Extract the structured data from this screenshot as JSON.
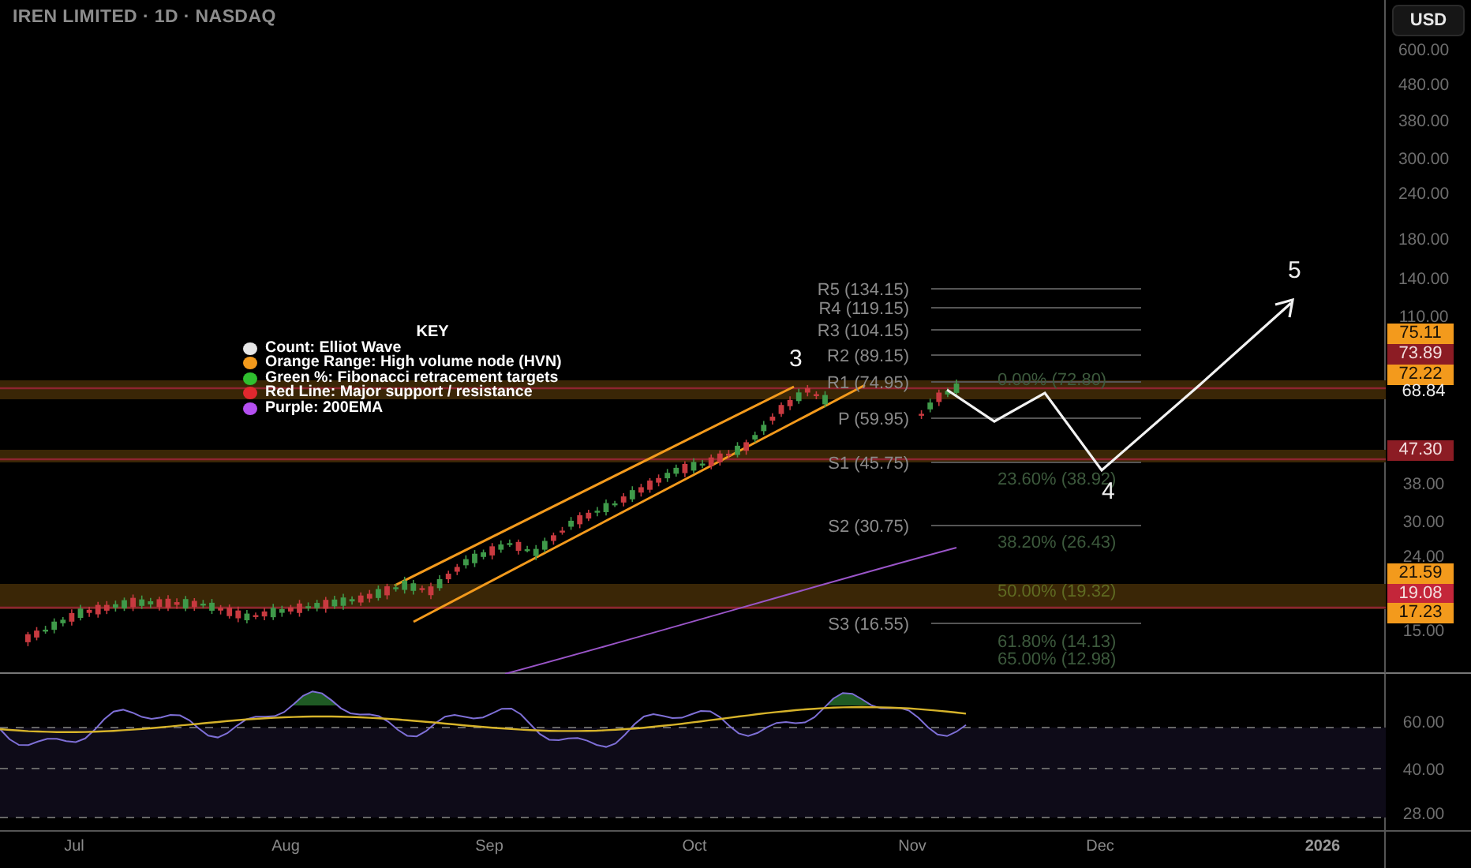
{
  "header": {
    "title": "IREN LIMITED · 1D · NASDAQ",
    "currency_button": "USD"
  },
  "legend": {
    "title": "KEY",
    "items": [
      {
        "label": "Count: Elliot Wave",
        "color": "#e6e6e6"
      },
      {
        "label": "Orange Range: High volume node (HVN)",
        "color": "#f39a1c"
      },
      {
        "label": "Green %: Fibonacci retracement targets",
        "color": "#2fbf2f"
      },
      {
        "label": "Red Line: Major support / resistance",
        "color": "#e0282e"
      },
      {
        "label": "Purple: 200EMA",
        "color": "#b44ff0"
      }
    ]
  },
  "wave_labels": [
    {
      "text": "3"
    },
    {
      "text": "4"
    },
    {
      "text": "5"
    }
  ],
  "pivot_levels": [
    {
      "label": "R5 (134.15)"
    },
    {
      "label": "R4 (119.15)"
    },
    {
      "label": "R3 (104.15)"
    },
    {
      "label": "R2 (89.15)"
    },
    {
      "label": "R1 (74.95)"
    },
    {
      "label": "P (59.95)"
    },
    {
      "label": "S1 (45.75)"
    },
    {
      "label": "S2 (30.75)"
    },
    {
      "label": "S3 (16.55)"
    }
  ],
  "fib_levels": [
    {
      "label": "0.00% (72.80)",
      "color": "#3d5a3d"
    },
    {
      "label": "23.60% (38.92)",
      "color": "#3d5a3d"
    },
    {
      "label": "38.20% (26.43)",
      "color": "#3d5a3d"
    },
    {
      "label": "50.00% (19.32)",
      "color": "#5f6b22"
    },
    {
      "label": "61.80% (14.13)",
      "color": "#3d5a3d"
    },
    {
      "label": "65.00% (12.98)",
      "color": "#3d5a3d"
    }
  ],
  "price_axis": {
    "labels": [
      {
        "text": "600.00",
        "kind": "tick"
      },
      {
        "text": "480.00",
        "kind": "tick"
      },
      {
        "text": "380.00",
        "kind": "tick"
      },
      {
        "text": "300.00",
        "kind": "tick"
      },
      {
        "text": "240.00",
        "kind": "tick"
      },
      {
        "text": "180.00",
        "kind": "tick"
      },
      {
        "text": "140.00",
        "kind": "tick"
      },
      {
        "text": "110.00",
        "kind": "tick"
      },
      {
        "text": "75.11",
        "kind": "tag",
        "color": "#f39a1c"
      },
      {
        "text": "73.89",
        "kind": "tag",
        "color": "#8c1c24"
      },
      {
        "text": "72.22",
        "kind": "tag",
        "color": "#f39a1c"
      },
      {
        "text": "68.84",
        "kind": "last"
      },
      {
        "text": "47.30",
        "kind": "tag",
        "color": "#8c1c24"
      },
      {
        "text": "38.00",
        "kind": "tick"
      },
      {
        "text": "30.00",
        "kind": "tick"
      },
      {
        "text": "24.00",
        "kind": "tick"
      },
      {
        "text": "21.59",
        "kind": "tag",
        "color": "#f39a1c"
      },
      {
        "text": "19.08",
        "kind": "tag",
        "color": "#c4263a"
      },
      {
        "text": "17.23",
        "kind": "tag",
        "color": "#f39a1c"
      },
      {
        "text": "15.00",
        "kind": "tick"
      }
    ]
  },
  "rsi_axis": {
    "labels": [
      "60.00",
      "40.00",
      "28.00"
    ]
  },
  "time_axis": {
    "labels": [
      {
        "text": "Jul",
        "kind": "month"
      },
      {
        "text": "Aug",
        "kind": "month"
      },
      {
        "text": "Sep",
        "kind": "month"
      },
      {
        "text": "Oct",
        "kind": "month"
      },
      {
        "text": "Nov",
        "kind": "month"
      },
      {
        "text": "Dec",
        "kind": "month"
      },
      {
        "text": "2026",
        "kind": "year"
      }
    ]
  }
}
